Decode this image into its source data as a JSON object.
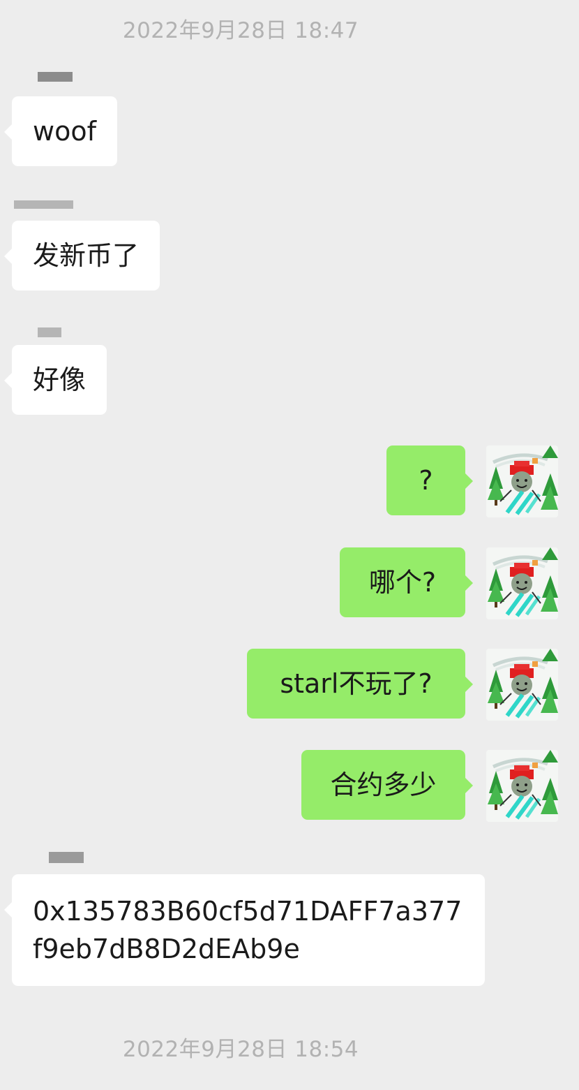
{
  "timestamps": [
    "2022年9月28日 18:47",
    "2022年9月28日 18:54"
  ],
  "messages": [
    {
      "side": "in",
      "text": "woof"
    },
    {
      "side": "in",
      "text": "发新币了"
    },
    {
      "side": "in",
      "text": "好像"
    },
    {
      "side": "out",
      "text": "?"
    },
    {
      "side": "out",
      "text": "哪个?"
    },
    {
      "side": "out",
      "text": "starl不玩了?"
    },
    {
      "side": "out",
      "text": "合约多少"
    },
    {
      "side": "in",
      "text": "0x135783B60cf5d71DAFF7a377f9eb7dB8D2dEAb9e"
    }
  ],
  "colors": {
    "background": "#ededed",
    "incoming_bubble": "#ffffff",
    "outgoing_bubble": "#95ec69",
    "timestamp_text": "#b2b2b2"
  },
  "icons": {
    "self_avatar": "pixel-art-skier-avatar-icon"
  }
}
